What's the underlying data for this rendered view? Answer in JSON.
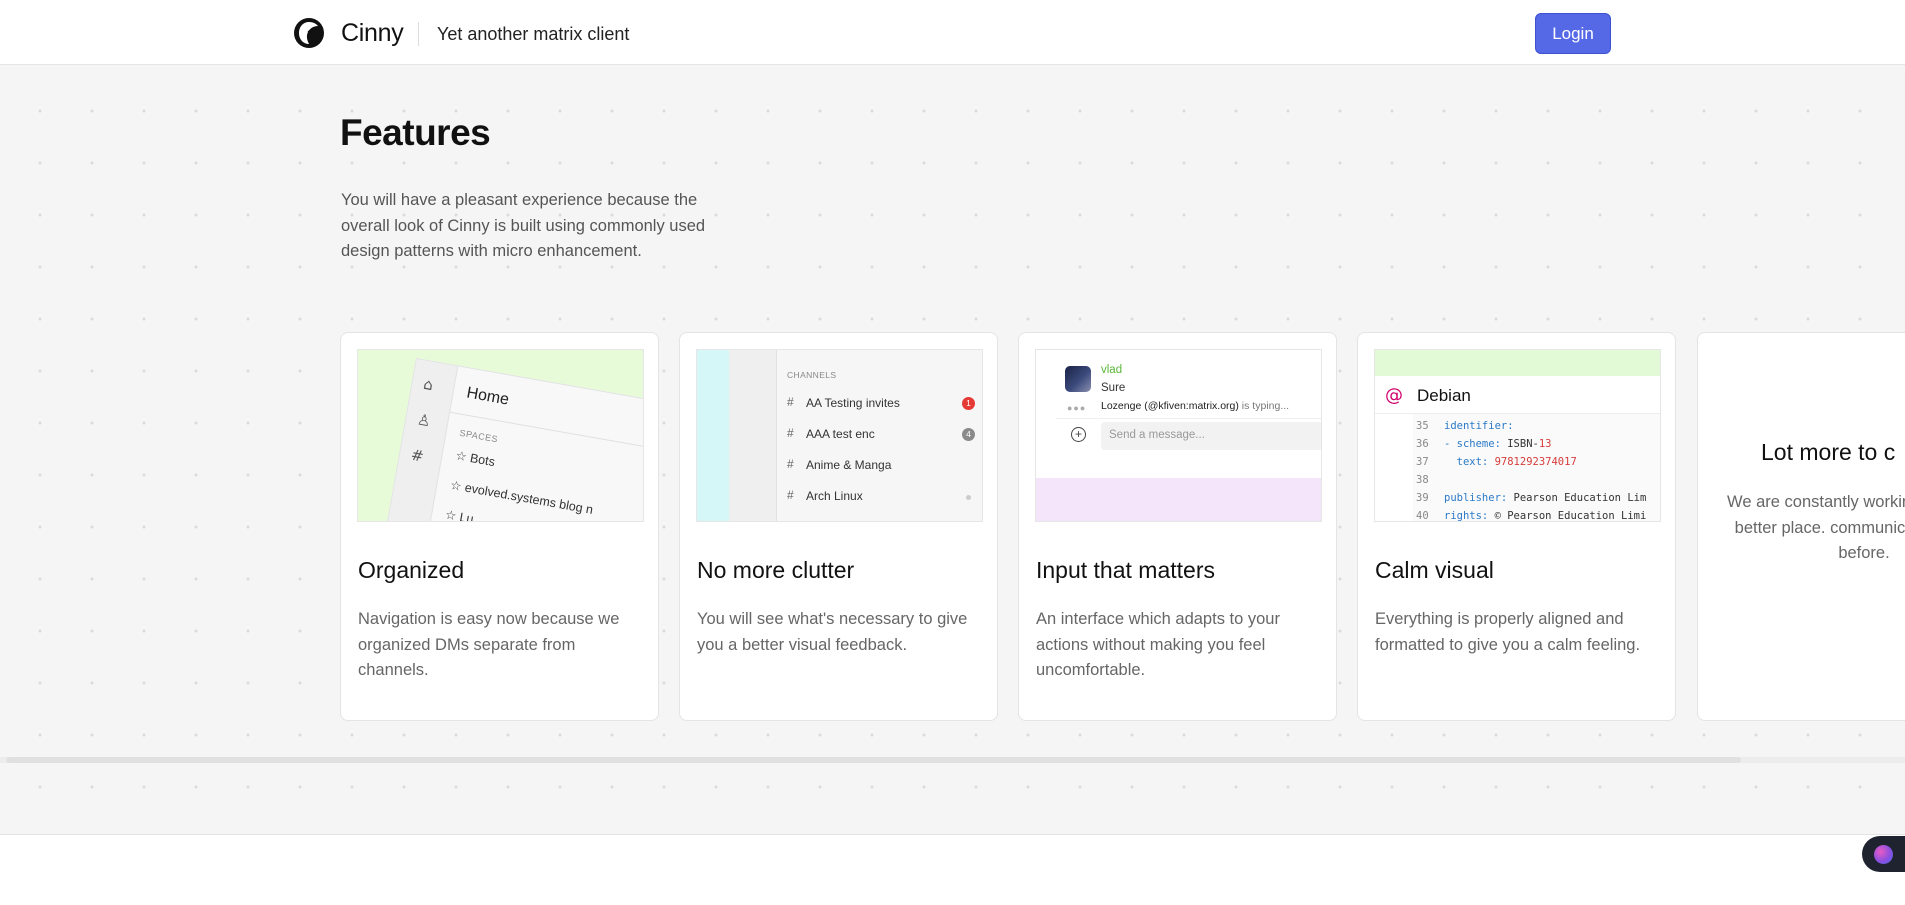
{
  "header": {
    "brand": "Cinny",
    "tagline": "Yet another matrix client",
    "login_label": "Login"
  },
  "features": {
    "title": "Features",
    "description": "You will have a pleasant experience because the overall look of Cinny is built using commonly used design patterns with micro enhancement."
  },
  "cards": [
    {
      "title": "Organized",
      "description": "Navigation is easy now because we organized DMs separate from channels.",
      "preview": {
        "home_label": "Home",
        "section_label": "SPACES",
        "items": [
          "Bots",
          "evolved.systems blog n",
          "Lu"
        ]
      }
    },
    {
      "title": "No more clutter",
      "description": "You will see what's necessary to give you a better visual feedback.",
      "preview": {
        "section_label": "CHANNELS",
        "channels": [
          {
            "name": "AA Testing invites",
            "badge": "1",
            "badge_color": "#e53935"
          },
          {
            "name": "AAA test enc",
            "badge": "4",
            "badge_color": "#8a8a8a"
          },
          {
            "name": "Anime & Manga",
            "badge": "",
            "badge_color": ""
          },
          {
            "name": "Arch Linux",
            "badge": "",
            "badge_color": "#cccccc"
          }
        ]
      }
    },
    {
      "title": "Input that matters",
      "description": "An interface which adapts to your actions without making you feel uncomfortable.",
      "preview": {
        "username": "vlad",
        "message": "Sure",
        "typing_user": "Lozenge (@kfiven:matrix.org)",
        "typing_suffix": " is typing...",
        "input_placeholder": "Send a message..."
      }
    },
    {
      "title": "Calm visual",
      "description": "Everything is properly aligned and formatted to give you a calm feeling.",
      "preview": {
        "title": "Debian",
        "lines": [
          {
            "n": "35",
            "key": "identifier:",
            "val": "",
            "num": ""
          },
          {
            "n": "36",
            "key": "- scheme:",
            "val": " ISBN-",
            "num": "13"
          },
          {
            "n": "37",
            "key": "  text:",
            "val": " ",
            "num": "9781292374017"
          },
          {
            "n": "38",
            "key": "",
            "val": "",
            "num": ""
          },
          {
            "n": "39",
            "key": "publisher:",
            "val": " Pearson Education Lim",
            "num": ""
          },
          {
            "n": "40",
            "key": "rights:",
            "val": " © Pearson Education Limi",
            "num": ""
          }
        ]
      }
    },
    {
      "title": "Lot more to c",
      "description": "We are constantly workin to make it a better place. communication like ne before."
    }
  ],
  "colors": {
    "accent": "#5568e6",
    "background": "#f5f5f5",
    "card": "#ffffff"
  },
  "icons": {
    "logo": "cinny-logo-icon",
    "float": "extension-brain-icon"
  }
}
